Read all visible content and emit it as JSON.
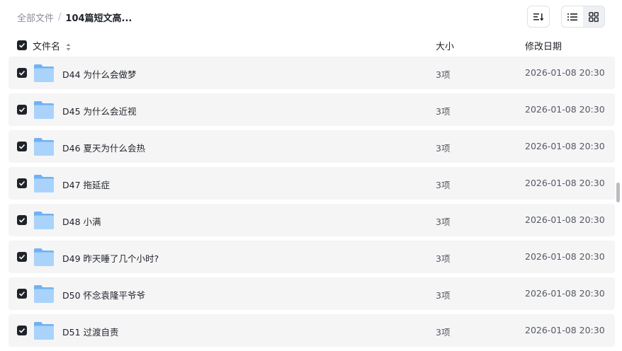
{
  "breadcrumb": {
    "root": "全部文件",
    "separator": "/",
    "current": "104篇短文高..."
  },
  "toolbar": {
    "sort_icon": "sort-icon",
    "list_view_icon": "list-view-icon",
    "grid_view_icon": "grid-view-icon",
    "active_view": "list"
  },
  "columns": {
    "name": "文件名",
    "size": "大小",
    "modified": "修改日期"
  },
  "select_all_checked": true,
  "rows": [
    {
      "name": "D44 为什么会做梦",
      "size": "3项",
      "modified": "2026-01-08 20:30",
      "checked": true
    },
    {
      "name": "D45 为什么会近视",
      "size": "3项",
      "modified": "2026-01-08 20:30",
      "checked": true
    },
    {
      "name": "D46 夏天为什么会热",
      "size": "3项",
      "modified": "2026-01-08 20:30",
      "checked": true
    },
    {
      "name": "D47 拖延症",
      "size": "3项",
      "modified": "2026-01-08 20:30",
      "checked": true
    },
    {
      "name": "D48 小满",
      "size": "3项",
      "modified": "2026-01-08 20:30",
      "checked": true
    },
    {
      "name": "D49 昨天睡了几个小时?",
      "size": "3项",
      "modified": "2026-01-08 20:30",
      "checked": true
    },
    {
      "name": "D50 怀念袁隆平爷爷",
      "size": "3项",
      "modified": "2026-01-08 20:30",
      "checked": true
    },
    {
      "name": "D51 过渡自责",
      "size": "3项",
      "modified": "2026-01-08 20:30",
      "checked": true
    }
  ],
  "colors": {
    "row_bg": "#f5f5f6",
    "checkbox": "#1f2329",
    "folder_light": "#a9d3fb",
    "folder_dark": "#6fb1f4"
  }
}
